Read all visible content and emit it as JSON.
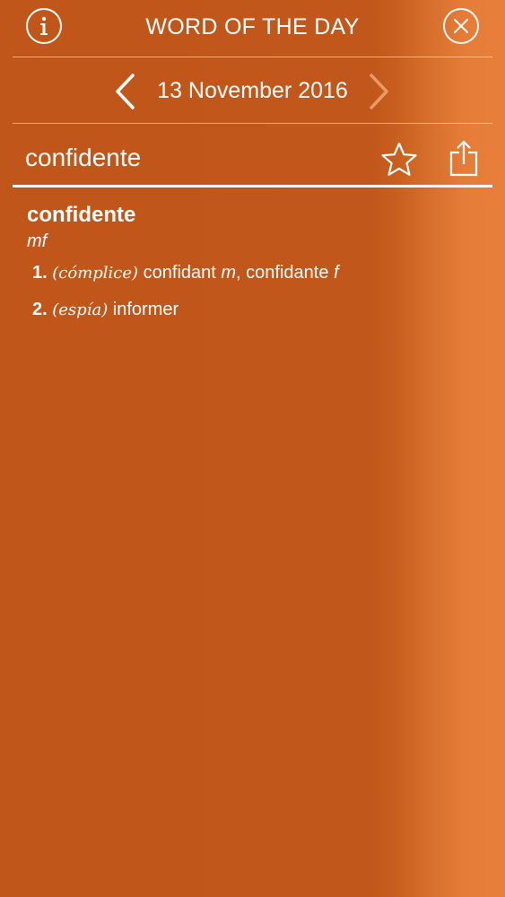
{
  "header": {
    "title": "WORD OF THE DAY",
    "info_icon": "info-icon",
    "close_icon": "close-icon"
  },
  "date_nav": {
    "date": "13 November 2016",
    "prev_icon": "chevron-left-icon",
    "next_icon": "chevron-right-icon"
  },
  "word_bar": {
    "word": "confidente",
    "favorite_icon": "star-icon",
    "share_icon": "share-icon"
  },
  "entry": {
    "headword": "confidente",
    "part_of_speech": "mf",
    "senses": [
      {
        "number": "1.",
        "context": "cómplice",
        "translation_1": "confidant",
        "gender_1": "m",
        "translation_2": "confidante",
        "gender_2": "f"
      },
      {
        "number": "2.",
        "context": "espía",
        "translation": "informer"
      }
    ]
  },
  "colors": {
    "background": "#c2571b",
    "background_edge": "#e8803c",
    "foreground": "#ffffff",
    "disabled_arrow": "#e89a6c"
  }
}
